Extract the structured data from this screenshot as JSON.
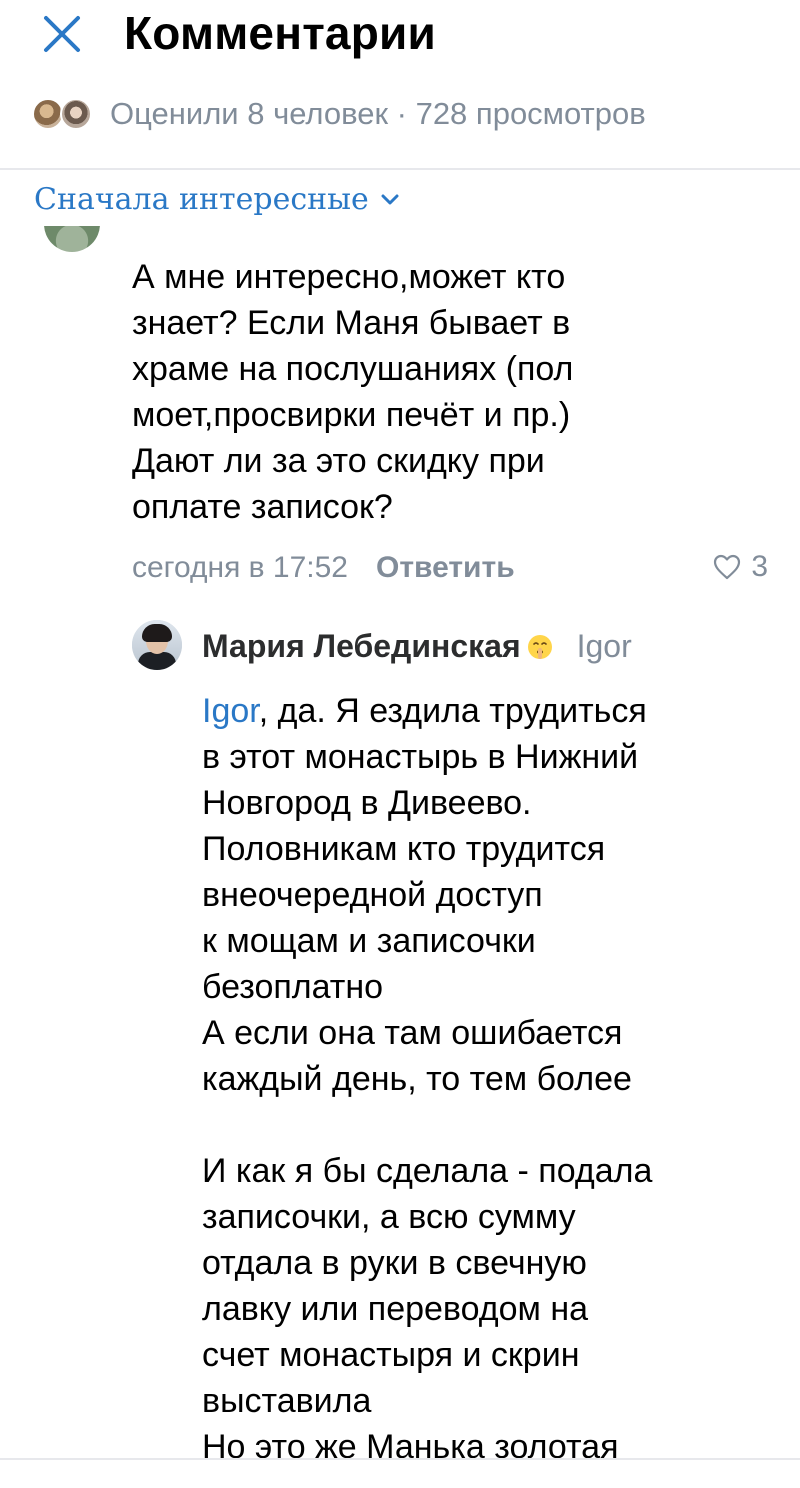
{
  "header": {
    "title": "Комментарии",
    "close_icon": "close-icon",
    "stats_text": "Оценили 8 человек · 728 просмотров"
  },
  "sort": {
    "label": "Сначала интересные",
    "icon": "chevron-down-icon"
  },
  "comment": {
    "text": "А мне интересно,может кто\nзнает? Если Маня бывает в\nхраме на послушаниях (пол\nмоет,просвирки печёт и пр.)\nДают ли за это скидку при\nоплате записок?",
    "timestamp": "сегодня в 17:52",
    "reply_label": "Ответить",
    "likes": "3"
  },
  "reply": {
    "author": "Мария Лебединская",
    "emoji_icon": "shushing-face-emoji-icon",
    "reply_to": "Igor",
    "mention": "Igor",
    "text": ", да. Я ездила трудиться\nв этот монастырь в Нижний\nНовгород в Дивеево.\nПоловникам кто трудится\nвнеочередной доступ\nк мощам и записочки\nбезоплатно\nА если она там ошибается\nкаждый день, то тем более\n\nИ как я бы сделала - подала\nзаписочки, а всю сумму\nотдала в руки в свечную\nлавку или переводом на\nсчет монастыря и скрин\nвыставила\nНо это же Манька золотая"
  },
  "colors": {
    "accent": "#2a78c6",
    "secondary_text": "#818c99",
    "divider": "#e7e8ec"
  }
}
